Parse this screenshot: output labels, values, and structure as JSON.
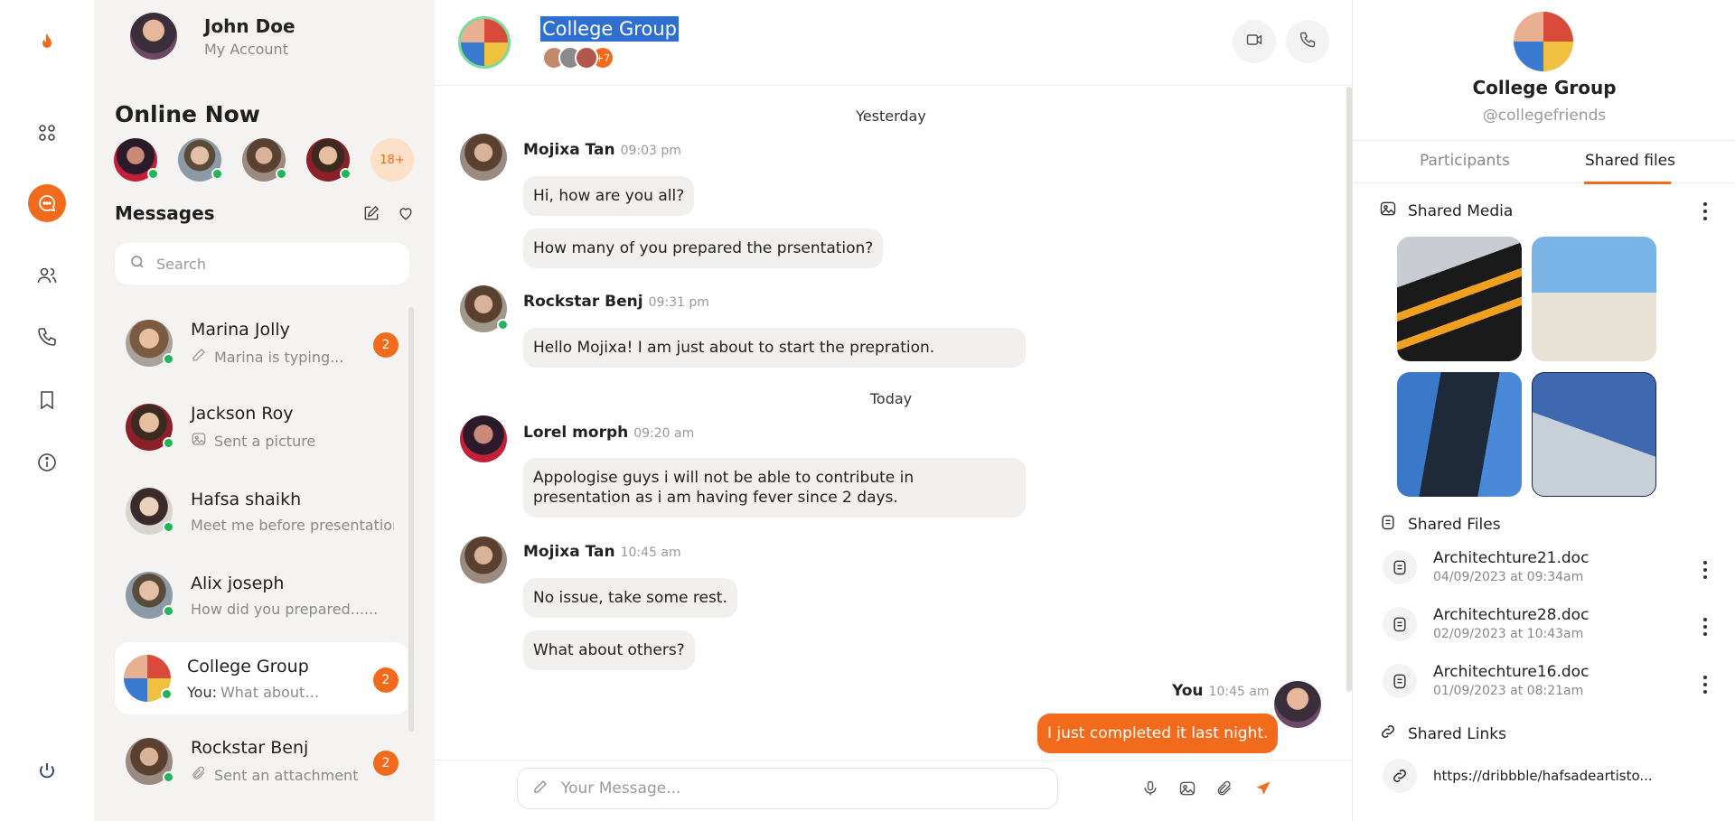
{
  "colors": {
    "accent": "#f26b1d",
    "online": "#22b45a",
    "selection": "#2f6fd0"
  },
  "rail": {
    "icons": [
      "flame-logo-icon",
      "apps-grid-icon",
      "chat-icon",
      "contacts-icon",
      "phone-icon",
      "bookmark-icon",
      "info-icon",
      "power-icon"
    ]
  },
  "profile": {
    "name": "John Doe",
    "sub": "My Account"
  },
  "online": {
    "title": "Online Now",
    "more": "18+"
  },
  "messages": {
    "title": "Messages",
    "search_placeholder": "Search",
    "conversations": [
      {
        "name": "Marina Jolly",
        "preview": "Marina is typing...",
        "badge": "2"
      },
      {
        "name": "Jackson Roy",
        "preview": "Sent a picture"
      },
      {
        "name": "Hafsa shaikh",
        "preview": "Meet me before presentation..."
      },
      {
        "name": "Alix joseph",
        "preview": "How did you prepared......"
      },
      {
        "name": "College Group",
        "preview_prefix": "You:",
        "preview": "What about others?",
        "badge": "2"
      },
      {
        "name": "Rockstar Benj",
        "preview": "Sent an attachment",
        "badge": "2"
      }
    ]
  },
  "chat": {
    "title": "College Group",
    "members_more": "+7",
    "composer_placeholder": "Your Message...",
    "days": {
      "yesterday": "Yesterday",
      "today": "Today"
    },
    "messages": [
      {
        "sender": "Mojixa Tan",
        "time": "09:03 pm",
        "texts": [
          "Hi, how are you all?",
          "How many of you prepared the prsentation?"
        ]
      },
      {
        "sender": "Rockstar Benj",
        "time": "09:31 pm",
        "texts": [
          "Hello Mojixa! I am just about to start the prepration."
        ]
      },
      {
        "sender": "Lorel morph",
        "time": "09:20 am",
        "texts": [
          "Appologise guys i will not be able to contribute in presentation as i am having fever since 2 days."
        ]
      },
      {
        "sender": "Mojixa Tan",
        "time": "10:45 am",
        "texts": [
          "No issue, take some rest.",
          "What about others?"
        ]
      },
      {
        "sender": "You",
        "time": "10:45 am",
        "texts": [
          "I just completed it last night."
        ]
      }
    ]
  },
  "details": {
    "name": "College Group",
    "handle": "@collegefriends",
    "tabs": [
      "Participants",
      "Shared files"
    ],
    "active_tab": "Shared files",
    "shared_media_title": "Shared Media",
    "shared_files_title": "Shared Files",
    "shared_links_title": "Shared Links",
    "files": [
      {
        "name": "Architechture21.doc",
        "date": "04/09/2023 at 09:34am"
      },
      {
        "name": "Architechture28.doc",
        "date": "02/09/2023 at 10:43am"
      },
      {
        "name": "Architechture16.doc",
        "date": "01/09/2023 at 08:21am"
      }
    ],
    "link": "https://dribbble/hafsadeartisto..."
  }
}
